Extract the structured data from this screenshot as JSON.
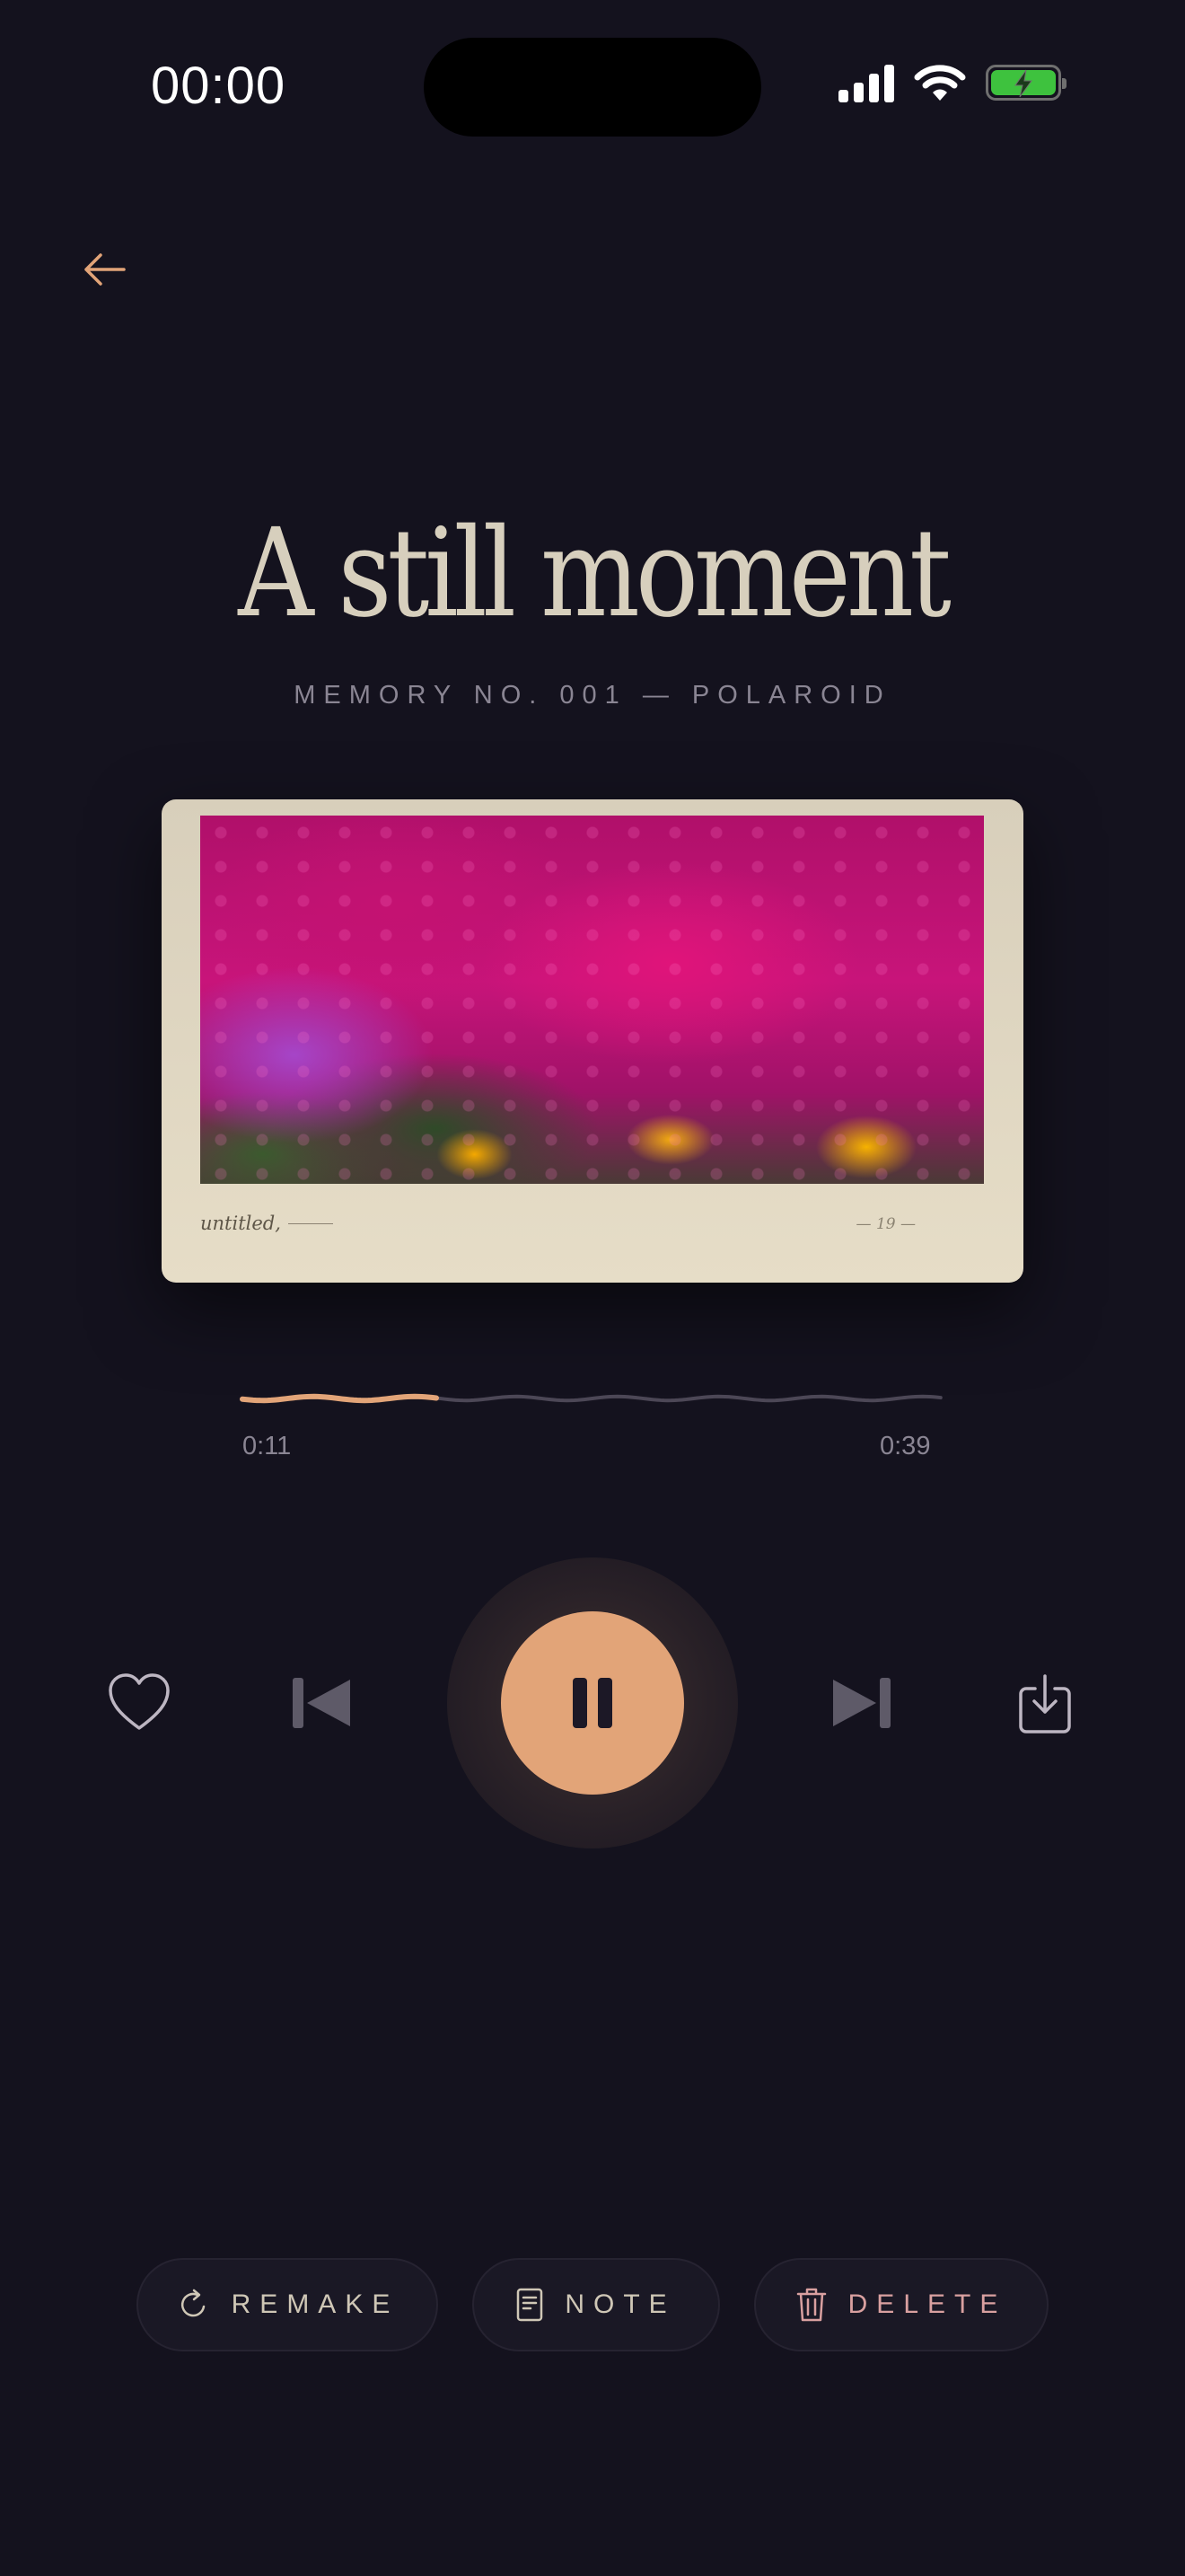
{
  "status_bar": {
    "time": "00:00",
    "battery_state": "charging"
  },
  "header": {
    "back_icon": "arrow-left-icon"
  },
  "memory": {
    "title": "A still moment",
    "subtitle": "MEMORY NO. 001 — POLAROID",
    "caption": "untitled,",
    "print_number": "— 19 —"
  },
  "player": {
    "current_time": "0:11",
    "total_time": "0:39",
    "progress_fraction": 0.28,
    "state": "playing"
  },
  "controls": {
    "like_icon": "heart-icon",
    "prev_icon": "skip-back-icon",
    "play_icon": "pause-icon",
    "next_icon": "skip-forward-icon",
    "save_icon": "download-icon"
  },
  "actions": {
    "remake": "REMAKE",
    "note": "NOTE",
    "delete": "DELETE"
  },
  "colors": {
    "background": "#14121e",
    "accent": "#e2a478",
    "text": "#d7cfbd",
    "delete": "#d9a0a0"
  }
}
